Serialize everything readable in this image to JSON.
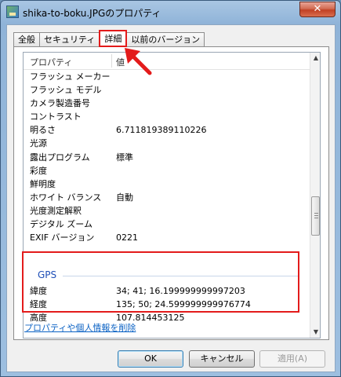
{
  "window": {
    "title": "shika-to-boku.JPGのプロパティ",
    "close_label": "✕"
  },
  "tabs": [
    {
      "label": "全般",
      "active": false
    },
    {
      "label": "セキュリティ",
      "active": false
    },
    {
      "label": "詳細",
      "active": true
    },
    {
      "label": "以前のバージョン",
      "active": false
    }
  ],
  "list": {
    "header": {
      "name": "プロパティ",
      "value": "値"
    },
    "rows": [
      {
        "name": "フラッシュ メーカー",
        "value": ""
      },
      {
        "name": "フラッシュ モデル",
        "value": ""
      },
      {
        "name": "カメラ製造番号",
        "value": ""
      },
      {
        "name": "コントラスト",
        "value": ""
      },
      {
        "name": "明るさ",
        "value": "6.711819389110226"
      },
      {
        "name": "光源",
        "value": ""
      },
      {
        "name": "露出プログラム",
        "value": "標準"
      },
      {
        "name": "彩度",
        "value": ""
      },
      {
        "name": "鮮明度",
        "value": ""
      },
      {
        "name": "ホワイト バランス",
        "value": "自動"
      },
      {
        "name": "光度測定解釈",
        "value": ""
      },
      {
        "name": "デジタル ズーム",
        "value": ""
      },
      {
        "name": "EXIF バージョン",
        "value": "0221"
      }
    ],
    "gps": {
      "heading": "GPS",
      "rows": [
        {
          "name": "緯度",
          "value": "34; 41; 16.199999999997203"
        },
        {
          "name": "経度",
          "value": "135; 50; 24.599999999976774"
        },
        {
          "name": "高度",
          "value": "107.814453125"
        }
      ]
    }
  },
  "remove_link": "プロパティや個人情報を削除",
  "buttons": {
    "ok": "OK",
    "cancel": "キャンセル",
    "apply": "適用(A)"
  },
  "colors": {
    "annotation": "#e31b1b",
    "link": "#0b62c4",
    "gps_heading": "#1f4fb7"
  }
}
